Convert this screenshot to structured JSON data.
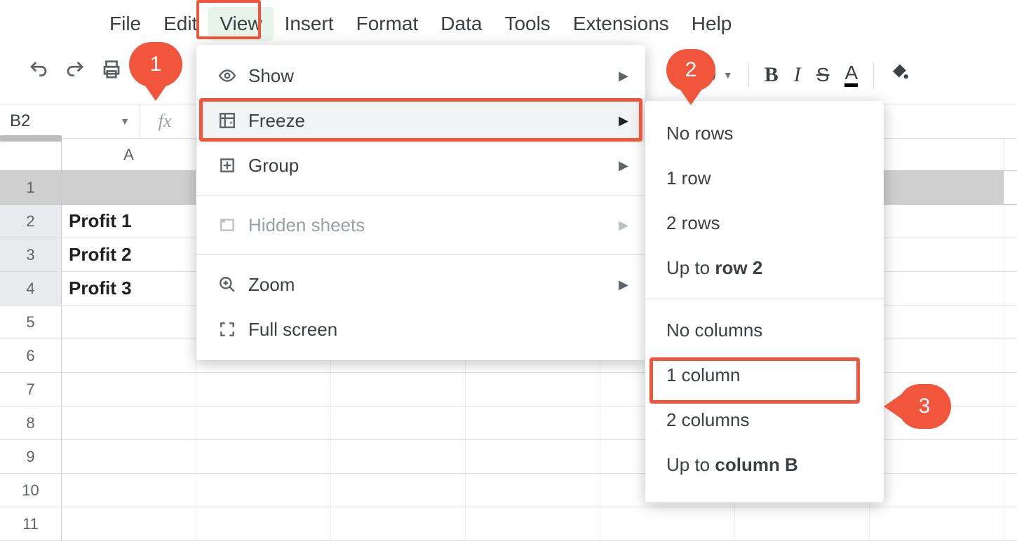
{
  "menubar": {
    "file": "File",
    "edit": "Edit",
    "view": "View",
    "insert": "Insert",
    "format": "Format",
    "data": "Data",
    "tools": "Tools",
    "extensions": "Extensions",
    "help": "Help"
  },
  "toolbar": {
    "font_size": "10"
  },
  "namebox": "B2",
  "columns": [
    "A"
  ],
  "rows": [
    "1",
    "2",
    "3",
    "4",
    "5",
    "6",
    "7",
    "8",
    "9",
    "10",
    "11"
  ],
  "cells": {
    "A2": "Profit 1",
    "A3": "Profit 2",
    "A4": "Profit 3"
  },
  "view_menu": {
    "show": "Show",
    "freeze": "Freeze",
    "group": "Group",
    "hidden_sheets": "Hidden sheets",
    "zoom": "Zoom",
    "full_screen": "Full screen"
  },
  "freeze_submenu": {
    "no_rows": "No rows",
    "one_row": "1 row",
    "two_rows": "2 rows",
    "up_to_row_prefix": "Up to ",
    "up_to_row_bold": "row 2",
    "no_columns": "No columns",
    "one_column": "1 column",
    "two_columns": "2 columns",
    "up_to_col_prefix": "Up to ",
    "up_to_col_bold": "column B"
  },
  "callouts": {
    "one": "1",
    "two": "2",
    "three": "3"
  }
}
